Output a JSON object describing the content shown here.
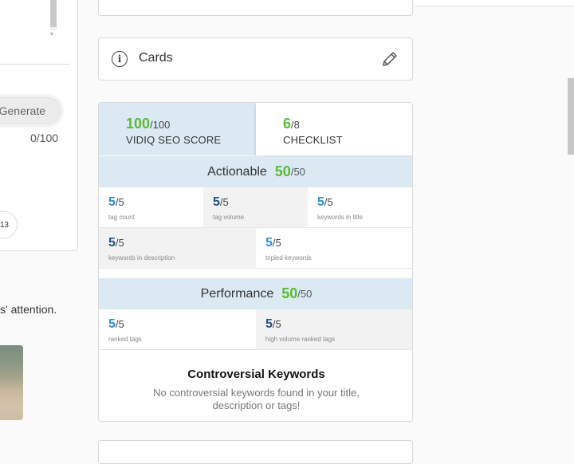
{
  "left_panel": {
    "generate_label": "Generate",
    "char_count": "0/100",
    "pill_text": "13",
    "attention_text": "s' attention."
  },
  "cards_row": {
    "label": "Cards"
  },
  "seo": {
    "tabs": [
      {
        "score": "100",
        "max": "/100",
        "label": "VIDIQ SEO SCORE"
      },
      {
        "score": "6",
        "max": "/8",
        "label": "CHECKLIST"
      }
    ],
    "actionable": {
      "title": "Actionable",
      "score": "50",
      "max": "/50",
      "items": [
        {
          "score": "5",
          "max": "/5",
          "label": "tag count"
        },
        {
          "score": "5",
          "max": "/5",
          "label": "tag volume"
        },
        {
          "score": "5",
          "max": "/5",
          "label": "keywords in title"
        },
        {
          "score": "5",
          "max": "/5",
          "label": "keywords in description"
        },
        {
          "score": "5",
          "max": "/5",
          "label": "tripled keywords"
        }
      ]
    },
    "performance": {
      "title": "Performance",
      "score": "50",
      "max": "/50",
      "items": [
        {
          "score": "5",
          "max": "/5",
          "label": "ranked tags"
        },
        {
          "score": "5",
          "max": "/5",
          "label": "high volume ranked tags"
        }
      ]
    },
    "controversial": {
      "title": "Controversial Keywords",
      "text": "No controversial keywords found in your title, description or tags!"
    }
  },
  "colors": {
    "green": "#5bbb33",
    "light_blue": "#2f8fd6",
    "dark_blue": "#1f4f86",
    "header_bg": "#dbe9f3"
  }
}
